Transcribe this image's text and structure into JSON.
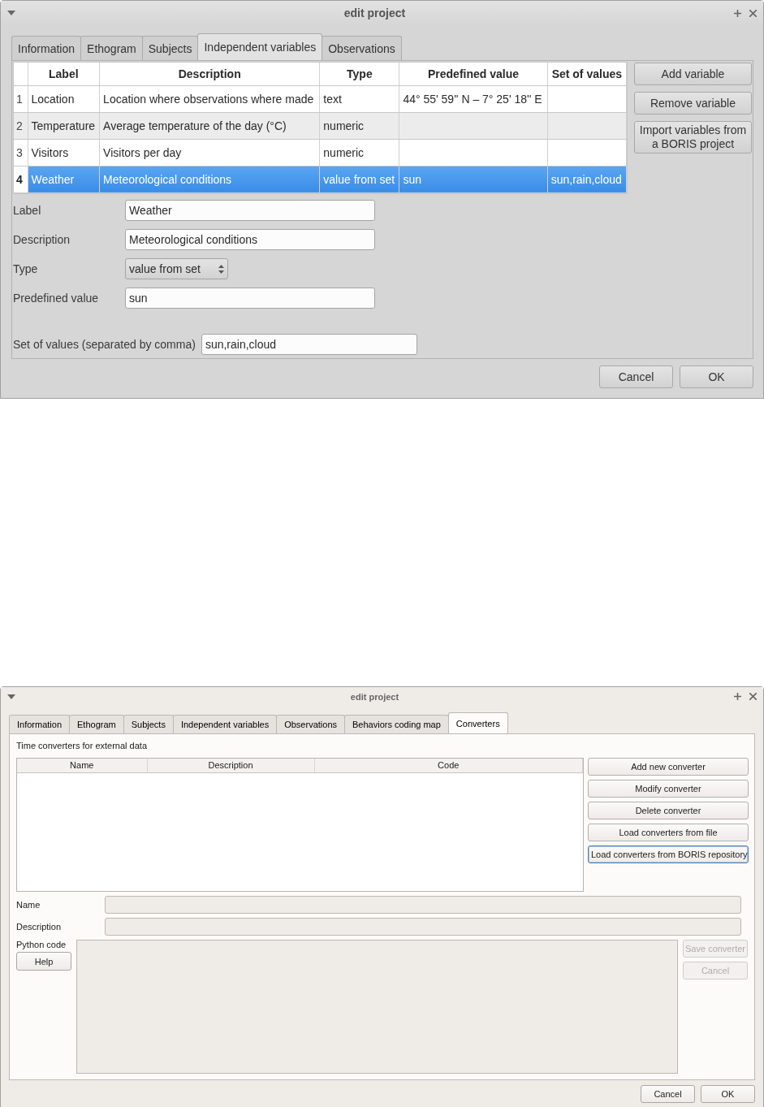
{
  "dialogs": [
    {
      "kind": "variables",
      "title": "edit project",
      "tabs": [
        {
          "label": "Information",
          "selected": false
        },
        {
          "label": "Ethogram",
          "selected": false
        },
        {
          "label": "Subjects",
          "selected": false
        },
        {
          "label": "Independent variables",
          "selected": true
        },
        {
          "label": "Observations",
          "selected": false
        }
      ],
      "table": {
        "columns": [
          "Label",
          "Description",
          "Type",
          "Predefined value",
          "Set of values"
        ],
        "rows": [
          {
            "number": "1",
            "selected": false,
            "cells": [
              "Location",
              "Location where observations where made",
              "text",
              "44° 55' 59'' N – 7° 25' 18'' E",
              ""
            ]
          },
          {
            "number": "2",
            "selected": false,
            "cells": [
              "Temperature",
              "Average temperature of the day (°C)",
              "numeric",
              "",
              ""
            ]
          },
          {
            "number": "3",
            "selected": false,
            "cells": [
              "Visitors",
              "Visitors per day",
              "numeric",
              "",
              ""
            ]
          },
          {
            "number": "4",
            "selected": true,
            "cells": [
              "Weather",
              "Meteorological conditions",
              "value from set",
              "sun",
              "sun,rain,cloud"
            ]
          }
        ]
      },
      "side_buttons": [
        "Add variable",
        "Remove variable",
        "Import variables from a BORIS project"
      ],
      "fields": [
        {
          "label": "Label",
          "kind": "text",
          "value": "Weather"
        },
        {
          "label": "Description",
          "kind": "text",
          "value": "Meteorological conditions"
        },
        {
          "label": "Type",
          "kind": "select",
          "value": "value from set"
        },
        {
          "label": "Predefined value",
          "kind": "text",
          "value": "sun"
        }
      ],
      "set_of_values": {
        "label": "Set of values (separated by comma)",
        "value": "sun,rain,cloud"
      },
      "buttons": [
        "Cancel",
        "OK"
      ]
    },
    {
      "kind": "converters",
      "title": "edit project",
      "tabs": [
        {
          "label": "Information",
          "selected": false
        },
        {
          "label": "Ethogram",
          "selected": false
        },
        {
          "label": "Subjects",
          "selected": false
        },
        {
          "label": "Independent variables",
          "selected": false
        },
        {
          "label": "Observations",
          "selected": false
        },
        {
          "label": "Behaviors coding map",
          "selected": false
        },
        {
          "label": "Converters",
          "selected": true
        }
      ],
      "heading": "Time converters for external data",
      "table": {
        "columns": [
          "Name",
          "Description",
          "Code"
        ]
      },
      "side_buttons": [
        {
          "label": "Add new converter",
          "focused": false
        },
        {
          "label": "Modify converter",
          "focused": false
        },
        {
          "label": "Delete converter",
          "focused": false
        },
        {
          "label": "Load converters from file",
          "focused": false
        },
        {
          "label": "Load converters from BORIS repository",
          "focused": true
        }
      ],
      "fields": [
        {
          "label": "Name",
          "disabled": true
        },
        {
          "label": "Description",
          "disabled": true
        }
      ],
      "code_label": "Python code",
      "help_button": "Help",
      "code_editor": {
        "disabled": true
      },
      "editor_buttons": [
        {
          "label": "Save converter",
          "disabled": true
        },
        {
          "label": "Cancel",
          "disabled": true
        }
      ],
      "buttons": [
        "Cancel",
        "OK"
      ]
    }
  ]
}
